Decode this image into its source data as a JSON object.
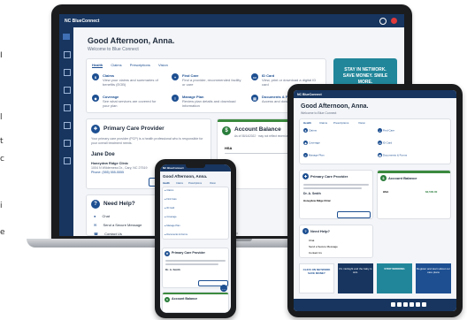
{
  "portal": {
    "logo": "NC BlueConnect",
    "greeting": "Good Afternoon, Anna.",
    "welcome": "Welcome to Blue Connect",
    "tabs": [
      "Health",
      "Claims",
      "Prescriptions",
      "Vision"
    ],
    "quick_links": [
      {
        "title": "Claims",
        "desc": "View your claims and summaries of benefits (EOB)"
      },
      {
        "title": "Find Care",
        "desc": "Find a provider, recommended facility or care"
      },
      {
        "title": "ID Card",
        "desc": "View, print or download a digital ID card"
      },
      {
        "title": "Coverage",
        "desc": "See what services are covered for your plan"
      },
      {
        "title": "Manage Plan",
        "desc": "Review plan details and download information"
      },
      {
        "title": "Documents & Forms",
        "desc": "Access and download documents"
      }
    ],
    "pcp": {
      "title": "Primary Care Provider",
      "desc": "Your primary care provider (PCP) is a health professional who is responsible for your overall treatment needs.",
      "name": "Jane Doe",
      "name_short": "Dr. A. Smith",
      "clinic": "Honeydew Ridge Clinic",
      "address": "1004 N Wilderness Dr., Cary, NC 27519",
      "phone": "Phone: (555) 555-5555",
      "button": "Change Primary Care Provider"
    },
    "account_balance": {
      "title": "Account Balance",
      "subtitle": "As of 08/14/2022 · may not reflect recent activity",
      "label": "HSA",
      "amount": "$2,500.00"
    },
    "need_help": {
      "title": "Need Help?",
      "items": [
        "Chat",
        "Send a Secure Message",
        "Contact Us"
      ]
    },
    "promo": "STAY IN NETWORK. SAVE MONEY. SMILE MORE.",
    "mini_promos": [
      "CLICK ON NETWORK SAVE MONEY",
      "It's midnight and the baby is sick.",
      "STOP SMOKING",
      "Register and learn about our care plans"
    ]
  },
  "laptop_brand": "MacBook Pro",
  "left_edge_text": [
    "I",
    "l",
    "t",
    "c",
    "i",
    "e"
  ],
  "colors": {
    "brand_navy": "#17355f",
    "brand_blue": "#1d4f91",
    "accent_green": "#2a7d3b",
    "teal_promo": "#21869a",
    "bg": "#ffffff"
  }
}
